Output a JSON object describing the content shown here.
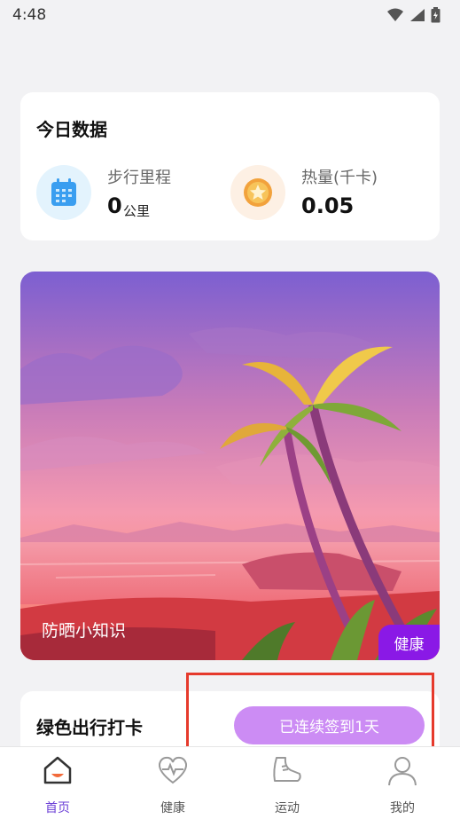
{
  "status_bar": {
    "time": "4:48"
  },
  "today_card": {
    "title": "今日数据",
    "metrics": [
      {
        "label": "步行里程",
        "value": "0",
        "unit": "公里",
        "icon": "calendar-icon"
      },
      {
        "label": "热量(千卡)",
        "value": "0.05",
        "icon": "star-coin-icon"
      }
    ]
  },
  "banner": {
    "caption": "防晒小知识",
    "tag": "健康"
  },
  "checkin": {
    "title": "绿色出行打卡",
    "button_label": "已连续签到1天"
  },
  "bottom_nav": {
    "items": [
      {
        "label": "首页",
        "icon": "home-icon",
        "active": true
      },
      {
        "label": "健康",
        "icon": "heart-pulse-icon",
        "active": false
      },
      {
        "label": "运动",
        "icon": "sneaker-icon",
        "active": false
      },
      {
        "label": "我的",
        "icon": "user-icon",
        "active": false
      }
    ]
  },
  "colors": {
    "accent": "#8a19e6",
    "button": "#cc8cf4",
    "active_nav": "#6b3fd6",
    "highlight": "#e63a2c"
  }
}
